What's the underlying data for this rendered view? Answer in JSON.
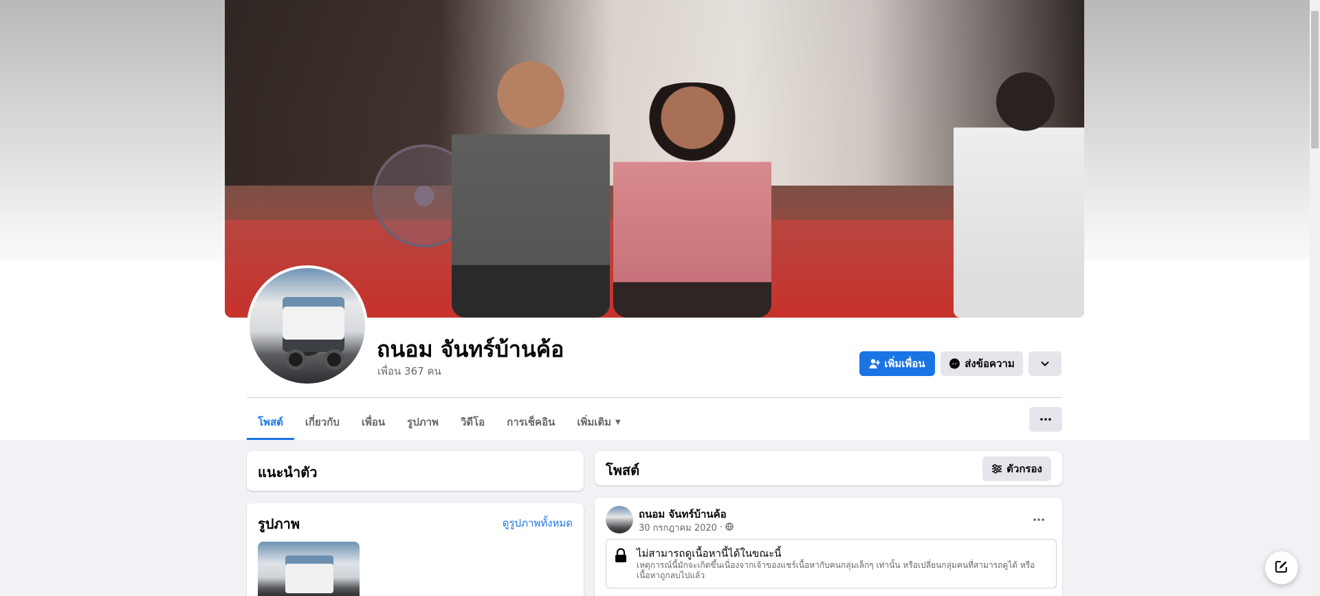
{
  "profile": {
    "name": "ถนอม จันทร์บ้านค้อ",
    "friends_count": "เพื่อน 367 คน"
  },
  "actions": {
    "add_friend": "เพิ่มเพื่อน",
    "message": "ส่งข้อความ"
  },
  "tabs": [
    {
      "label": "โพสต์",
      "active": true
    },
    {
      "label": "เกี่ยวกับ"
    },
    {
      "label": "เพื่อน"
    },
    {
      "label": "รูปภาพ"
    },
    {
      "label": "วิดีโอ"
    },
    {
      "label": "การเช็คอิน"
    },
    {
      "label": "เพิ่มเติม"
    }
  ],
  "intro": {
    "title": "แนะนำตัว"
  },
  "photos": {
    "title": "รูปภาพ",
    "see_all": "ดูรูปภาพทั้งหมด"
  },
  "posts": {
    "title": "โพสต์",
    "filter": "ตัวกรอง"
  },
  "post": {
    "author": "ถนอม จันทร์บ้านค้อ",
    "date": "30 กรกฎาคม 2020",
    "separator": "·",
    "privacy_icon": "globe-icon",
    "notice_title": "ไม่สามารถดูเนื้อหานี้ได้ในขณะนี้",
    "notice_body": "เหตุการณ์นี้มักจะเกิดขึ้นเนื่องจากเจ้าของแชร์เนื้อหากับคนกลุ่มเล็กๆ เท่านั้น หรือเปลี่ยนกลุ่มคนที่สามารถดูได้ หรือเนื้อหาถูกลบไปแล้ว"
  },
  "colors": {
    "accent": "#1b74e4",
    "secondary_button": "#e4e6eb",
    "page_background": "#f0f2f5"
  }
}
